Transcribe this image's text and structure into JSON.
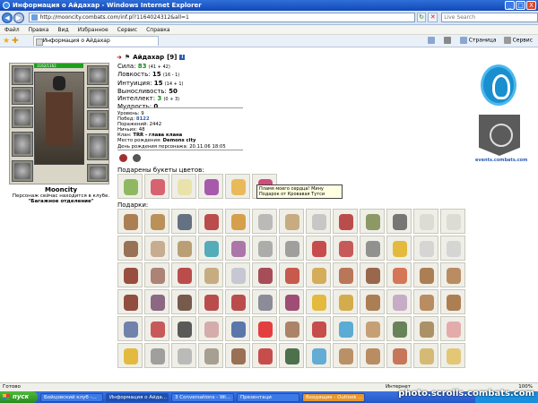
{
  "window": {
    "title": "Информация о Айдахар - Windows Internet Explorer",
    "controls": [
      "_",
      "□",
      "X"
    ]
  },
  "address": {
    "url": "http://mooncity.combats.com/inf.pl?1164024312&all=1",
    "search_placeholder": "Live Search"
  },
  "menu": [
    "Файл",
    "Правка",
    "Вид",
    "Избранное",
    "Сервис",
    "Справка"
  ],
  "tab": {
    "label": "Информация о Айдахар"
  },
  "toolbar": {
    "page": "Страница",
    "tools": "Сервис"
  },
  "character": {
    "name": "Айдахар",
    "level": "[9]",
    "hp": "1162/1162",
    "city": "Mooncity",
    "note": "Персонаж сейчас находится в клубе.",
    "location": "\"Багажное отделение\""
  },
  "stats": [
    {
      "label": "Сила:",
      "value": "83",
      "extra": "(41 + 42)",
      "green": true
    },
    {
      "label": "Ловкость:",
      "value": "15",
      "extra": "(16 - 1)",
      "green": false
    },
    {
      "label": "Интуиция:",
      "value": "15",
      "extra": "(14 + 1)",
      "green": false
    },
    {
      "label": "Выносливость:",
      "value": "50",
      "extra": "",
      "green": false
    },
    {
      "label": "Интеллект:",
      "value": "3",
      "extra": "(0 + 3)",
      "green": true
    },
    {
      "label": "Мудрость:",
      "value": "0",
      "extra": "",
      "green": false
    }
  ],
  "record": {
    "level": "Уровень: 9",
    "wins_label": "Побед:",
    "wins": "8122",
    "losses": "Поражений: 2442",
    "draws": "Ничьих: 48",
    "clan_label": "Клан:",
    "clan": "TRR - глава клана",
    "birthplace_label": "Место рождения:",
    "birthplace": "Demons city",
    "birthday_label": "День рождения персонажа:",
    "birthday": "20.11.06 18:05"
  },
  "flowers_title": "Подарены букеты цветов:",
  "tooltip": "Пламя моего сердца! Мину Подарок от Кровавая Тутси",
  "gifts_title": "Подарки:",
  "events_link": "events.combats.com",
  "status": {
    "left": "Готово",
    "zone": "Интернет",
    "zoom": "100%"
  },
  "taskbar": {
    "start": "пуск",
    "tasks": [
      "Бойцовский клуб -...",
      "Информация о Айда...",
      "3 Conversations - Wi...",
      "Презентаци",
      "Входящие - Outlook ..."
    ]
  },
  "watermark": "photo.scrolls.combats.com"
}
